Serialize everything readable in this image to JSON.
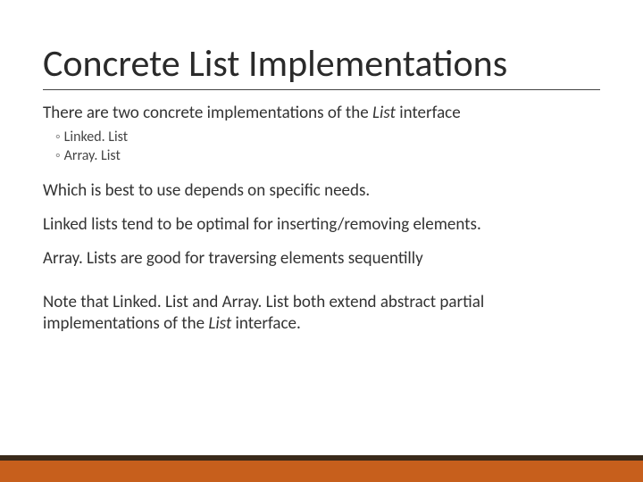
{
  "title": "Concrete List Implementations",
  "intro_1": "There are two concrete implementations of the ",
  "intro_italic": "List",
  "intro_2": " interface",
  "sub": {
    "a": "Linked. List",
    "b": "Array. List"
  },
  "p1": "Which is best to use depends on specific needs.",
  "p2": "Linked lists tend to be optimal for inserting/removing elements.",
  "p3": "Array. Lists are good for traversing elements sequentilly",
  "note_1": "Note that Linked. List and Array. List both extend abstract partial implementations of  the ",
  "note_italic": "List",
  "note_2": " interface."
}
